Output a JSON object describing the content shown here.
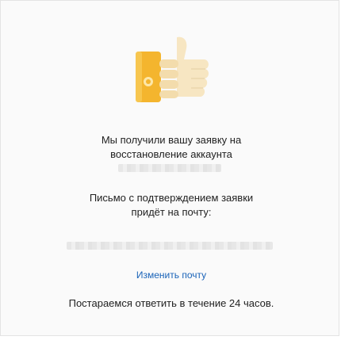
{
  "message": {
    "line1": "Мы получили вашу заявку на",
    "line2": "восстановление аккаунта"
  },
  "confirmation": {
    "line1": "Письмо с подтверждением заявки",
    "line2": "придёт на почту:"
  },
  "change_email_link": "Изменить почту",
  "footer_text": "Постараемся ответить в течение 24 часов.",
  "colors": {
    "link": "#1a63b8",
    "phone_body": "#f4b52e",
    "hand": "#f7e6c2"
  },
  "illustration": {
    "icon": "thumbs-up-with-phone"
  }
}
